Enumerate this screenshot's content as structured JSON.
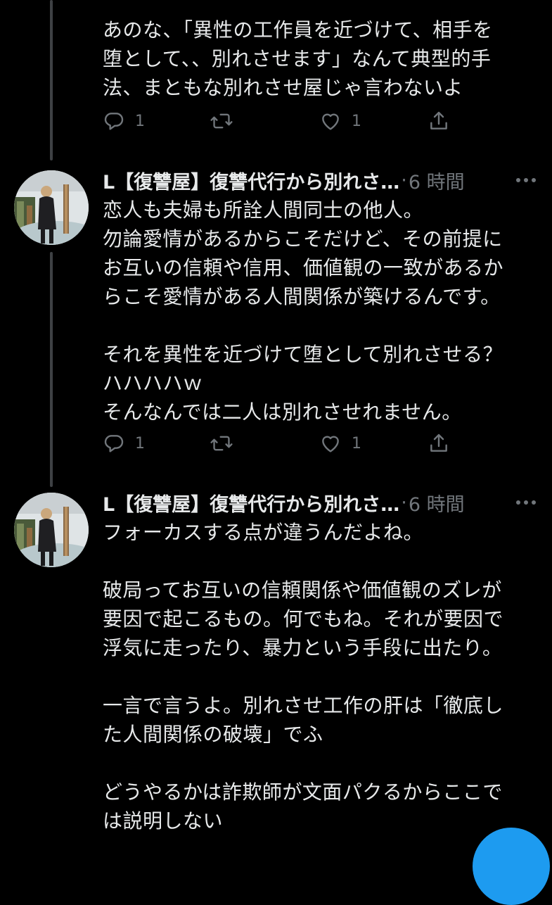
{
  "tweet_prev": {
    "lines": [
      "あのな、「異性の工作員を近づけて、相手を",
      "堕として、、別れさせます」なんて典型的手",
      "法、まともな別れさせ屋じゃ言わないよ"
    ],
    "reply_count": "1",
    "like_count": "1"
  },
  "tweet_1": {
    "name": "L【復讐屋】復讐代行から別れさ…",
    "separator": "·",
    "time": "6 時間",
    "lines": [
      "恋人も夫婦も所詮人間同士の他人。",
      "勿論愛情があるからこそだけど、その前提に",
      "お互いの信頼や信用、価値観の一致があるか",
      "らこそ愛情がある人間関係が築けるんです。",
      "",
      "それを異性を近づけて堕として別れさせる？",
      "ハハハハｗ",
      "そんなんでは二人は別れさせれません。"
    ],
    "reply_count": "1",
    "like_count": "1"
  },
  "tweet_2": {
    "name": "L【復讐屋】復讐代行から別れさ…",
    "separator": "·",
    "time": "6 時間",
    "lines": [
      "フォーカスする点が違うんだよね。",
      "",
      "破局ってお互いの信頼関係や価値観のズレが",
      "要因で起こるもの。何でもね。それが要因で",
      "浮気に走ったり、暴力という手段に出たり。",
      "",
      "一言で言うよ。別れさせ工作の肝は「徹底し",
      "た人間関係の破壊」でふ",
      "",
      "どうやるかは詐欺師が文面パクるからここで",
      "は説明しない"
    ]
  },
  "icons": {
    "reply": "reply-icon",
    "retweet": "retweet-icon",
    "like": "heart-icon",
    "share": "share-icon",
    "more": "more-dots-icon"
  },
  "colors": {
    "background": "#000000",
    "text": "#e7e9ea",
    "muted": "#71767b",
    "thread_line": "#3e4144",
    "accent": "#1d9bf0"
  }
}
